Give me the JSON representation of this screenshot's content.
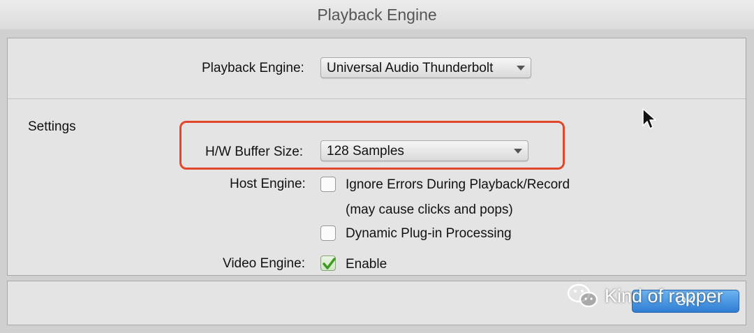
{
  "window": {
    "title": "Playback Engine"
  },
  "engine": {
    "label": "Playback Engine:",
    "value": "Universal Audio Thunderbolt"
  },
  "settings": {
    "heading": "Settings",
    "buffer": {
      "label": "H/W Buffer Size:",
      "value": "128 Samples"
    },
    "host_engine": {
      "label": "Host Engine:",
      "ignore_errors": {
        "label": "Ignore Errors During Playback/Record",
        "note": "(may cause clicks and pops)",
        "checked": false
      },
      "dynamic_plugin": {
        "label": "Dynamic Plug-in Processing",
        "checked": false
      }
    },
    "video_engine": {
      "label": "Video Engine:",
      "enable": {
        "label": "Enable",
        "checked": true
      }
    }
  },
  "footer": {
    "ok_label": "OK"
  },
  "watermark": {
    "text": "Kind of rapper",
    "icon": "wechat-icon"
  },
  "colors": {
    "highlight": "#e2462b",
    "ok_button": "#2f7dd3",
    "check": "#3f9a24"
  }
}
